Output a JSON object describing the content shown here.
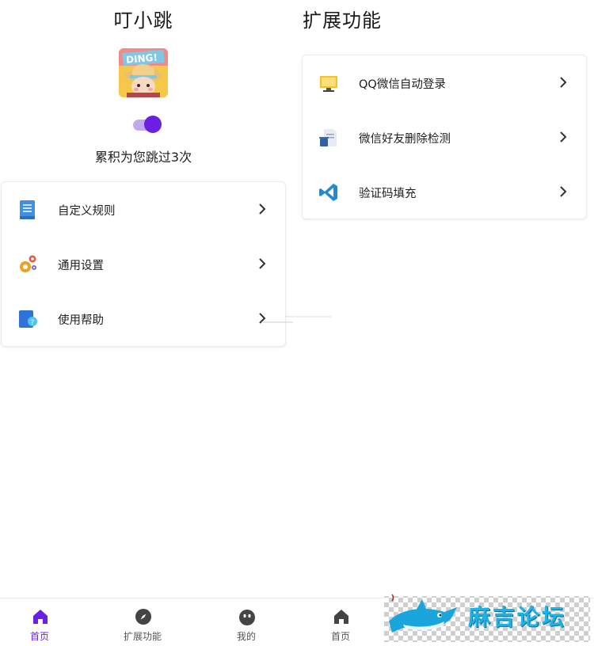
{
  "left_screen": {
    "title": "叮小跳",
    "avatar": {
      "badge_text": "DING!"
    },
    "service_toggle": {
      "on": true
    },
    "skip_count_text": "累积为您跳过3次",
    "menu": [
      {
        "label": "自定义规则",
        "icon": "document-icon"
      },
      {
        "label": "通用设置",
        "icon": "gears-icon"
      },
      {
        "label": "使用帮助",
        "icon": "help-icon"
      }
    ]
  },
  "right_screen": {
    "title": "扩展功能",
    "menu": [
      {
        "label": "QQ微信自动登录",
        "icon": "monitor-icon"
      },
      {
        "label": "微信好友删除检测",
        "icon": "document-trash-icon"
      },
      {
        "label": "验证码填充",
        "icon": "vscode-icon"
      }
    ]
  },
  "bottom_nav": [
    {
      "label": "首页",
      "icon": "home-icon",
      "active": true
    },
    {
      "label": "扩展功能",
      "icon": "compass-icon",
      "active": false
    },
    {
      "label": "我的",
      "icon": "face-icon",
      "active": false
    },
    {
      "label": "首页",
      "icon": "home-icon",
      "active": false
    }
  ],
  "watermark": {
    "text": "麻吉论坛"
  },
  "colors": {
    "accent": "#6a1fe2",
    "accent_light": "#c3a8ef",
    "icon_gray": "#444444",
    "chevron": "#333333"
  }
}
